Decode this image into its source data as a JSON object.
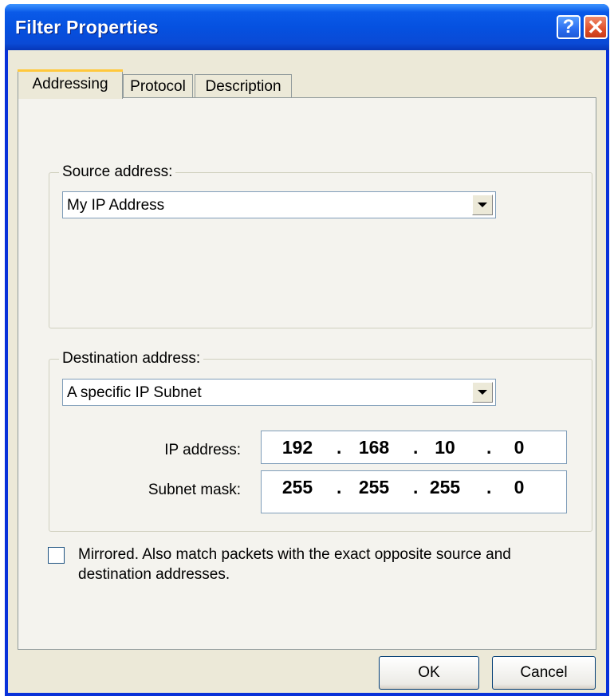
{
  "window": {
    "title": "Filter Properties",
    "help_label": "?",
    "close_label": "✕"
  },
  "tabs": [
    {
      "label": "Addressing",
      "active": true
    },
    {
      "label": "Protocol",
      "active": false
    },
    {
      "label": "Description",
      "active": false
    }
  ],
  "source": {
    "group_label": "Source address:",
    "selected": "My IP Address"
  },
  "destination": {
    "group_label": "Destination address:",
    "selected": "A specific IP Subnet",
    "ip_label": "IP address:",
    "ip_octets": [
      "192",
      "168",
      "10",
      "0"
    ],
    "mask_label": "Subnet mask:",
    "mask_octets": [
      "255",
      "255",
      "255",
      "0"
    ],
    "separator": "."
  },
  "mirrored": {
    "checked": false,
    "label": "Mirrored. Also match packets with the exact opposite source and destination addresses."
  },
  "buttons": {
    "ok": "OK",
    "cancel": "Cancel"
  },
  "colors": {
    "titlebar": "#0a5ae8",
    "dialog_bg": "#ece9d8",
    "active_tab_accent": "#ffc83c"
  }
}
